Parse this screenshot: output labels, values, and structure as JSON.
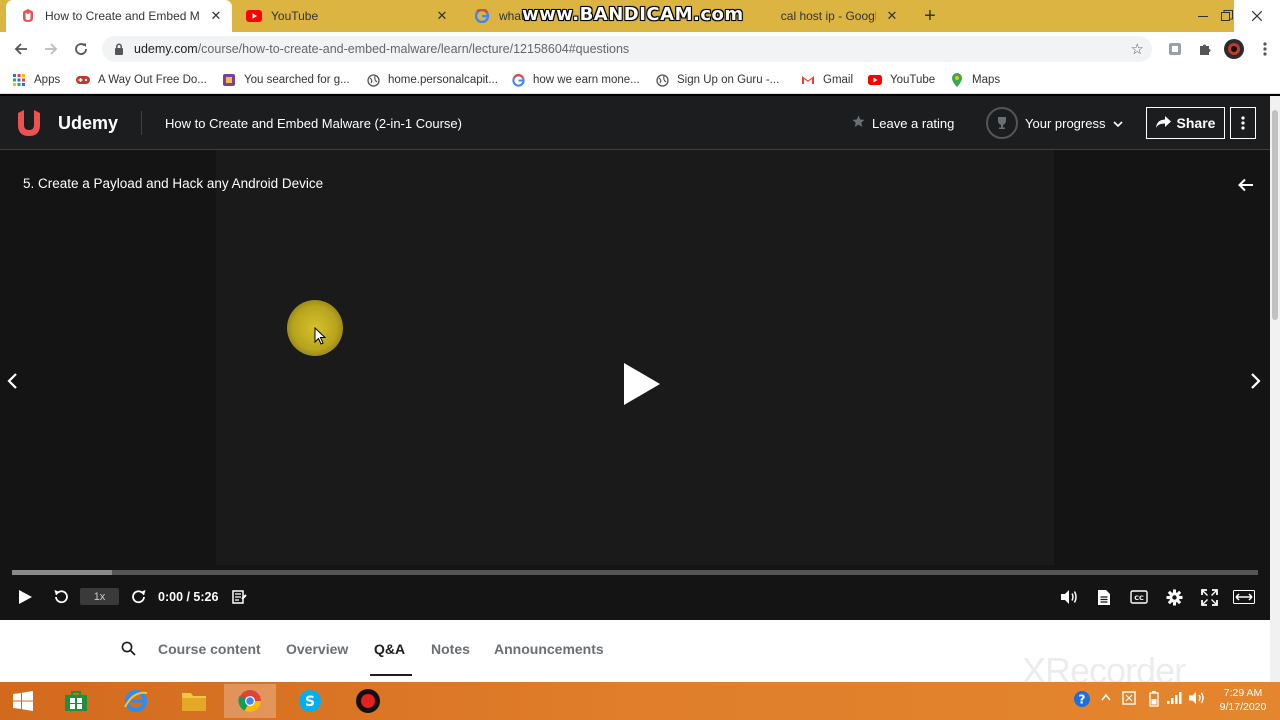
{
  "browser": {
    "tabs": [
      {
        "title": "How to Create and Embed Malwa",
        "icon": "udemy-favicon",
        "active": true
      },
      {
        "title": "YouTube",
        "icon": "youtube-favicon",
        "active": false
      },
      {
        "title_left": "what",
        "title_right": "cal host ip - Google Sear",
        "icon": "google-favicon",
        "active": false
      }
    ],
    "url_host": "udemy.com",
    "url_path": "/course/how-to-create-and-embed-malware/learn/lecture/12158604#questions",
    "bookmarks": [
      {
        "label": "Apps",
        "icon": "apps-grid-icon"
      },
      {
        "label": "A Way Out Free Do...",
        "icon": "gamepad-icon"
      },
      {
        "label": "You searched for g...",
        "icon": "bookmark-site-icon"
      },
      {
        "label": "home.personalcapit...",
        "icon": "globe-icon"
      },
      {
        "label": "how we earn mone...",
        "icon": "google-icon"
      },
      {
        "label": "Sign Up on Guru -...",
        "icon": "globe-icon"
      },
      {
        "label": "Gmail",
        "icon": "gmail-icon"
      },
      {
        "label": "YouTube",
        "icon": "youtube-icon"
      },
      {
        "label": "Maps",
        "icon": "maps-pin-icon"
      }
    ]
  },
  "watermarks": {
    "bandicam": "www.BANDICAM.com",
    "xrecorder": "XRecorder"
  },
  "udemy": {
    "logo_text": "Udemy",
    "course_title": "How to Create and Embed Malware (2-in-1 Course)",
    "leave_rating": "Leave a rating",
    "your_progress": "Your progress",
    "share": "Share"
  },
  "player": {
    "lecture_title": "5. Create a Payload and Hack any Android Device",
    "speed": "1x",
    "time": "0:00 / 5:26",
    "buffered_fraction": 0.08
  },
  "course_tabs": [
    {
      "label": "Course content",
      "active": false
    },
    {
      "label": "Overview",
      "active": false
    },
    {
      "label": "Q&A",
      "active": true
    },
    {
      "label": "Notes",
      "active": false
    },
    {
      "label": "Announcements",
      "active": false
    }
  ],
  "taskbar": {
    "clock_time": "7:29 AM",
    "clock_date": "9/17/2020"
  },
  "colors": {
    "chrome_frame": "#dcb441",
    "udemy_red": "#a435f0",
    "udemy_logo": "#ec5252",
    "taskbar": "#e07e2b"
  }
}
